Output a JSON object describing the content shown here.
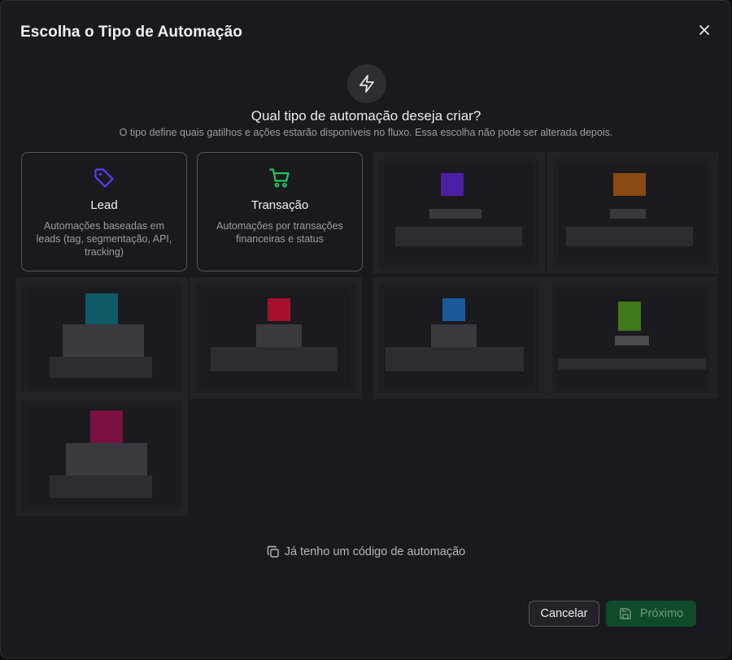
{
  "modal": {
    "title": "Escolha o Tipo de Automação",
    "question": "Qual tipo de automação deseja criar?",
    "subtitle": "O tipo define quais gatilhos e ações estarão disponíveis no fluxo. Essa escolha não pode ser alterada depois."
  },
  "cards": [
    {
      "name": "Lead",
      "description": "Automações baseadas em leads (tag, segmentação, API, tracking)",
      "icon": "tag-icon",
      "color": "#5b3df5"
    },
    {
      "name": "Transação",
      "description": "Automações por transações financeiras e status",
      "icon": "shopping-cart-icon",
      "color": "#22c55e"
    }
  ],
  "hidden_cards": [
    {
      "accent": "#4b1fa3"
    },
    {
      "accent": "#8a4a12"
    },
    {
      "accent": "#0e5a66"
    },
    {
      "accent": "#a8112e"
    },
    {
      "accent": "#1a5a99"
    },
    {
      "accent": "#3f7a1a"
    },
    {
      "accent": "#7a1040"
    }
  ],
  "footer": {
    "code_link": "Já tenho um código de automação",
    "cancel": "Cancelar",
    "next": "Próximo"
  }
}
